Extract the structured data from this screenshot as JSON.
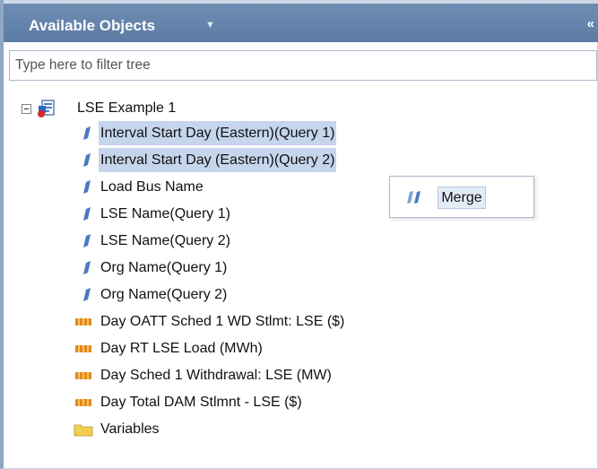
{
  "panel": {
    "title": "Available Objects",
    "title_menu_icon": "dropdown-caret-icon",
    "collapse_icon": "double-chevron-left-icon"
  },
  "filter": {
    "placeholder": "Type here to filter tree",
    "value": ""
  },
  "tree": {
    "root": {
      "label": "LSE Example 1",
      "icon": "report-icon",
      "expanded": true
    },
    "items": [
      {
        "label": "Interval Start Day (Eastern)(Query 1)",
        "type": "dimension",
        "selected": true
      },
      {
        "label": "Interval Start Day (Eastern)(Query 2)",
        "type": "dimension",
        "selected": true
      },
      {
        "label": "Load Bus Name",
        "type": "dimension",
        "selected": false
      },
      {
        "label": "LSE Name(Query 1)",
        "type": "dimension",
        "selected": false
      },
      {
        "label": "LSE Name(Query 2)",
        "type": "dimension",
        "selected": false
      },
      {
        "label": "Org Name(Query 1)",
        "type": "dimension",
        "selected": false
      },
      {
        "label": "Org Name(Query 2)",
        "type": "dimension",
        "selected": false
      },
      {
        "label": "Day OATT Sched 1 WD Stlmt: LSE ($)",
        "type": "measure",
        "selected": false
      },
      {
        "label": "Day RT LSE Load (MWh)",
        "type": "measure",
        "selected": false
      },
      {
        "label": "Day Sched 1 Withdrawal: LSE (MW)",
        "type": "measure",
        "selected": false
      },
      {
        "label": "Day Total DAM Stlmnt - LSE ($)",
        "type": "measure",
        "selected": false
      },
      {
        "label": "Variables",
        "type": "folder",
        "selected": false
      }
    ]
  },
  "context_menu": {
    "items": [
      {
        "label": "Merge",
        "icon": "merge-icon"
      }
    ]
  },
  "colors": {
    "header": "#6283ab",
    "selection": "#c5d5ec",
    "dimension": "#4a78c2",
    "measure": "#e08a1a",
    "folder": "#f2cf52"
  }
}
